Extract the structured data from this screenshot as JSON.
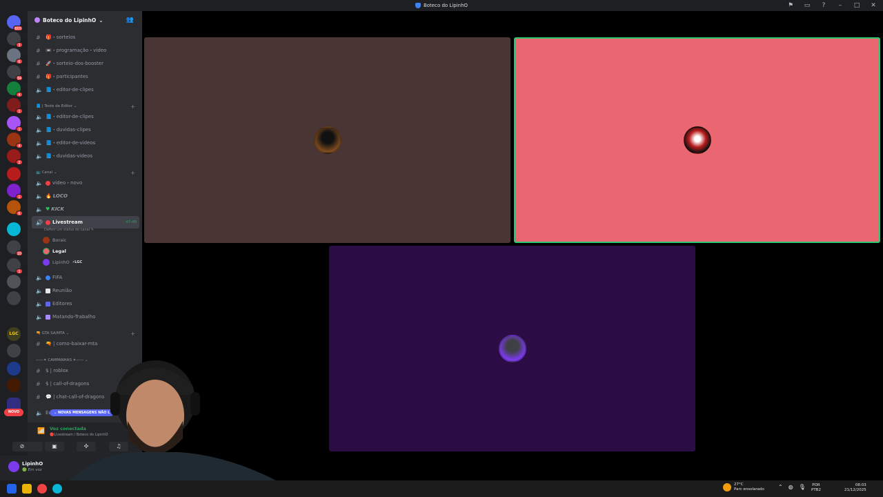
{
  "window": {
    "title": "Boteco do LipinhO"
  },
  "rail": {
    "badges": [
      "865",
      "3",
      "6",
      "34",
      "4",
      "1",
      "1",
      "4",
      "2",
      "1",
      "6",
      "10",
      "1"
    ],
    "new_label": "NOVO",
    "lgc_label": "LGC"
  },
  "guild": {
    "name": "Boteco do LipinhO"
  },
  "channels": {
    "sorteios": "🎁・sorteios",
    "programacao": "📼・programação・video",
    "booster": "🚀・sorteio-dos-booster",
    "participantes": "🎁・participantes",
    "editor_clipes_1": "📘・editor-de-clipes",
    "cat_teste": "📘 | Teste de Editor",
    "editor_clipes_2": "📘・editor-de-clipes",
    "duvidas_clipes": "📘・duvidas-clipes",
    "editor_videos": "📘・editor-de-videos",
    "duvidas_videos": "📘・duvidas-videos",
    "cat_canal": "📺 Canal",
    "video_novo": "video・novo",
    "loco": "LOCO",
    "kick": "KICK",
    "livestream": "Livestream",
    "livestream_time": "47:48",
    "livestream_status": "Definir um status do canal",
    "fifa": "FIFA",
    "reuniao": "Reunião",
    "editores": "Editores",
    "matando": "Matando-Trabalho",
    "cat_gta": "🔫 GTA SA/MTA",
    "baixar_mta": "🔫 | como-baixar-mta",
    "cat_campanhas": "——✦ CAMPANHAS ✦——",
    "roblox": "$ | roblox",
    "call_dragons": "$ | call-of-dragons",
    "chat_dragons": "💬 | chat-call-of-dragons",
    "partial": "Eu"
  },
  "voice_users": [
    "Boraic",
    "Legal",
    "LipinhO"
  ],
  "voice_user_tag": "LGC",
  "new_messages": "NOVAS MENSAGENS NÃO L",
  "voice_panel": {
    "status": "Voz conectada",
    "sub": "Livestream / Boteco do LipinhO"
  },
  "user": {
    "name": "LipinhO",
    "status": "Em voz"
  },
  "tiles": [
    {
      "color": "#4a3535"
    },
    {
      "color": "#ea6670"
    },
    {
      "color": "#2c0c44"
    }
  ],
  "taskbar": {
    "temp": "27°C",
    "weather": "Parc ensolarado",
    "lang1": "POR",
    "lang2": "PTB2",
    "time": "08:03",
    "date": "21/12/2025"
  }
}
